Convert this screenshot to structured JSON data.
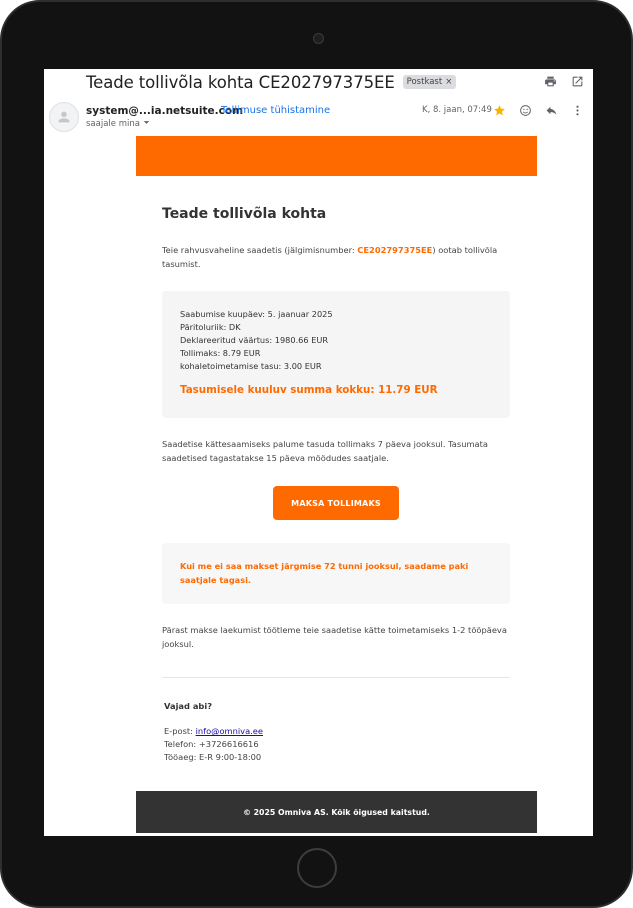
{
  "header": {
    "subject": "Teade tollivõla kohta CE202797375EE",
    "label": "Postkast",
    "label_close": "×"
  },
  "message": {
    "sender": "system@...ia.netsuite.com",
    "unsubscribe": "Tellimuse tühistamine",
    "recipient": "saajale mina",
    "date": "K, 8. jaan, 07:49"
  },
  "icons": [
    "print-icon",
    "open-in-new-window-icon",
    "avatar-person-icon",
    "star-icon",
    "emoji-icon",
    "reply-icon",
    "more-vert-icon",
    "dropdown-arrow-icon"
  ],
  "colors": {
    "accent": "#ff6a00",
    "footer": "#333333",
    "star": "#f6b400",
    "link": "#1a73e8"
  },
  "email": {
    "title": "Teade tollivõla kohta",
    "intro_before": "Teie rahvusvaheline saadetis (jälgimisnumber: ",
    "tracking_number": "CE202797375EE",
    "intro_after": ") ootab tollivõla tasumist.",
    "details": {
      "arrival": "Saabumise kuupäev: 5. jaanuar 2025",
      "origin": "Päritoluriik: DK",
      "declared": "Deklareeritud väärtus: 1980.66 EUR",
      "duty": "Tollimaks: 8.79 EUR",
      "delivery_fee": "kohaletoimetamise tasu: 3.00 EUR",
      "total": "Tasumisele kuuluv summa kokku: 11.79 EUR"
    },
    "instructions": "Saadetise kättesaamiseks palume tasuda tollimaks 7 päeva jooksul. Tasumata saadetised tagastatakse 15 päeva möödudes saatjale.",
    "pay_button": "MAKSA TOLLIMAKS",
    "warning": "Kui me ei saa makset järgmise 72 tunni jooksul, saadame paki saatjale tagasi.",
    "after_payment": "Pärast makse laekumist töötleme teie saadetise kätte toimetamiseks 1-2 tööpäeva jooksul.",
    "help_title": "Vajad abi?",
    "email_label": "E-post: ",
    "email_value": "info@omniva.ee",
    "phone": "Telefon: +3726616616",
    "hours": "Tööaeg: E-R 9:00-18:00",
    "footer": "© 2025 Omniva AS. Kõik õigused kaitstud."
  }
}
